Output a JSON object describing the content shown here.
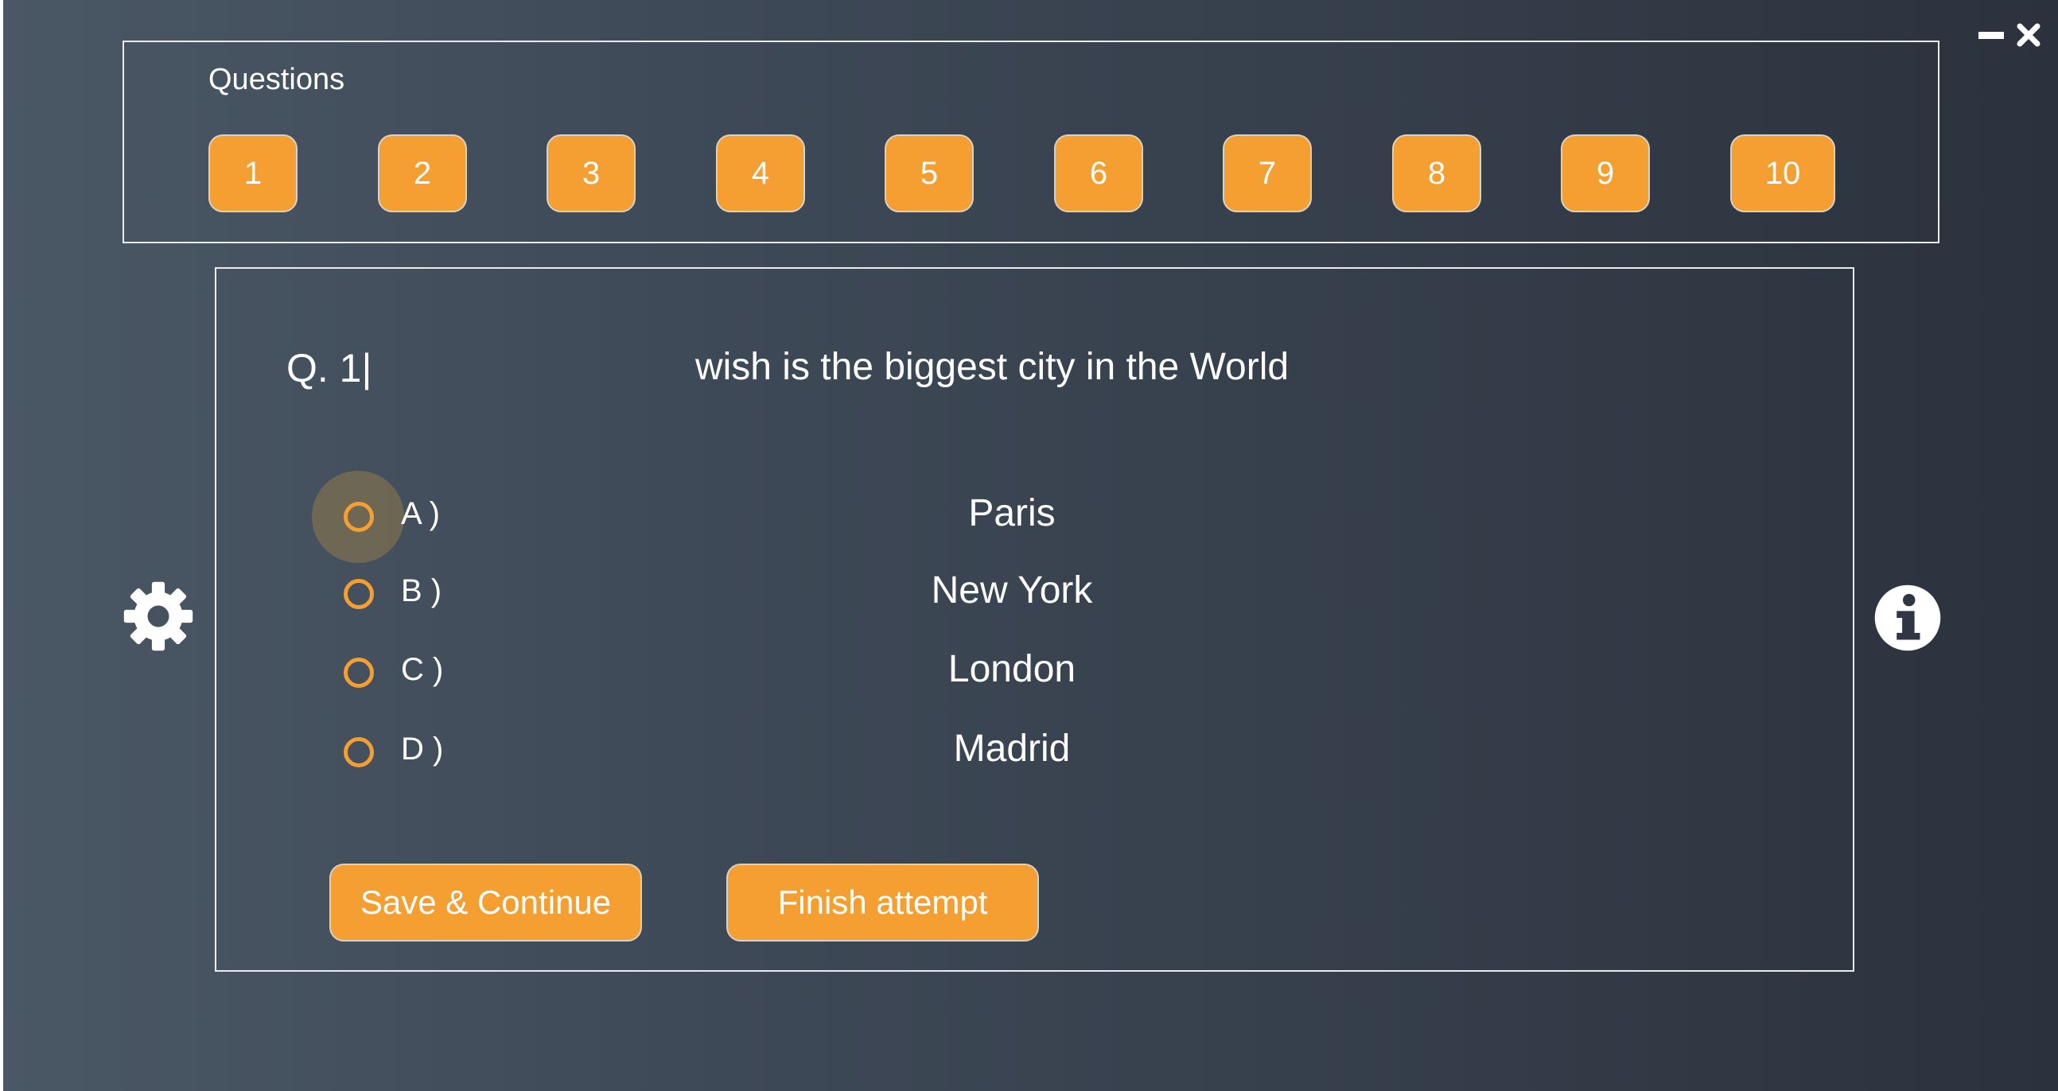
{
  "window": {
    "minimize_icon": "minimize-icon",
    "close_icon": "close-icon",
    "close_glyph": "✖"
  },
  "questions_panel": {
    "title": "Questions",
    "buttons": [
      "1",
      "2",
      "3",
      "4",
      "5",
      "6",
      "7",
      "8",
      "9",
      "10"
    ]
  },
  "question": {
    "number": "Q. 1|",
    "text": "wish is the biggest city in the World",
    "options": [
      {
        "letter": "A )",
        "text": "Paris"
      },
      {
        "letter": "B )",
        "text": "New York"
      },
      {
        "letter": "C )",
        "text": "London"
      },
      {
        "letter": "D )",
        "text": "Madrid"
      }
    ]
  },
  "actions": {
    "save_label": "Save & Continue",
    "finish_label": "Finish attempt"
  },
  "icons": {
    "settings": "gear-icon",
    "info": "info-icon"
  },
  "colors": {
    "accent": "#f59f33",
    "background_start": "#4a5764",
    "background_end": "#2b323d",
    "border": "#e8ecf0",
    "text": "#ffffff"
  }
}
